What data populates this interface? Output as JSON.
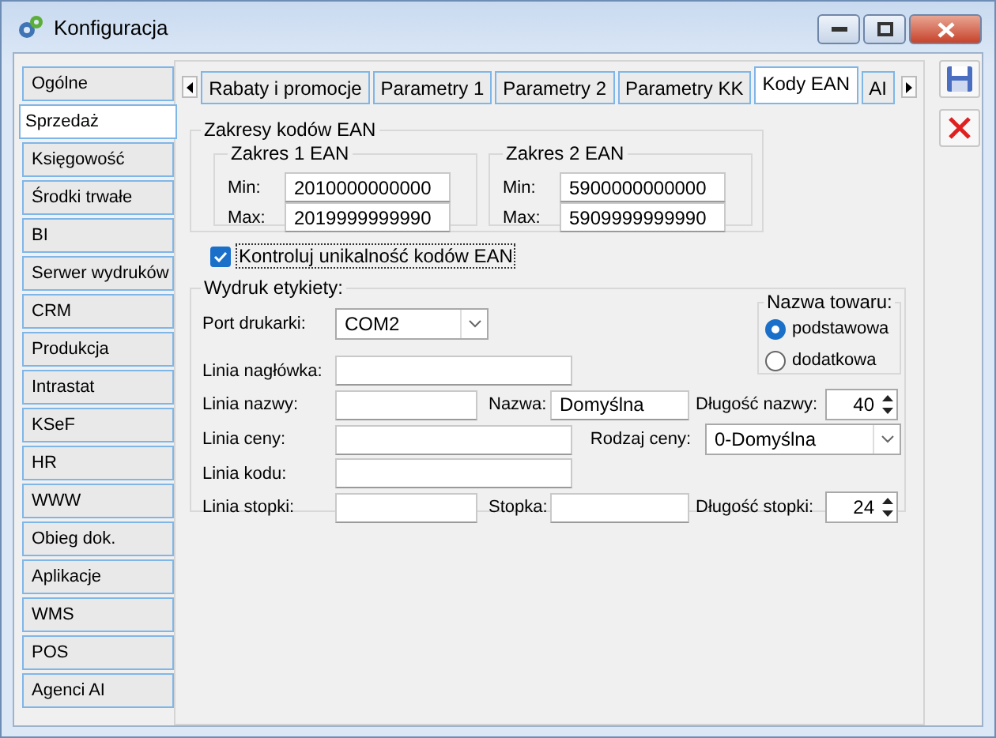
{
  "window": {
    "title": "Konfiguracja"
  },
  "sidebar": {
    "items": [
      {
        "label": "Ogólne",
        "selected": false
      },
      {
        "label": "Sprzedaż",
        "selected": true
      },
      {
        "label": "Księgowość",
        "selected": false
      },
      {
        "label": "Środki trwałe",
        "selected": false
      },
      {
        "label": "BI",
        "selected": false
      },
      {
        "label": "Serwer wydruków",
        "selected": false
      },
      {
        "label": "CRM",
        "selected": false
      },
      {
        "label": "Produkcja",
        "selected": false
      },
      {
        "label": "Intrastat",
        "selected": false
      },
      {
        "label": "KSeF",
        "selected": false
      },
      {
        "label": "HR",
        "selected": false
      },
      {
        "label": "WWW",
        "selected": false
      },
      {
        "label": "Obieg dok.",
        "selected": false
      },
      {
        "label": "Aplikacje",
        "selected": false
      },
      {
        "label": "WMS",
        "selected": false
      },
      {
        "label": "POS",
        "selected": false
      },
      {
        "label": "Agenci AI",
        "selected": false
      }
    ]
  },
  "tabs": [
    {
      "label": "Rabaty i promocje",
      "selected": false
    },
    {
      "label": "Parametry 1",
      "selected": false
    },
    {
      "label": "Parametry 2",
      "selected": false
    },
    {
      "label": "Parametry KK",
      "selected": false
    },
    {
      "label": "Kody EAN",
      "selected": true
    },
    {
      "label": "AI",
      "selected": false
    }
  ],
  "ean_ranges": {
    "title": "Zakresy kodów EAN",
    "ranges": [
      {
        "title": "Zakres 1 EAN",
        "min_label": "Min:",
        "min": "2010000000000",
        "max_label": "Max:",
        "max": "2019999999990"
      },
      {
        "title": "Zakres 2 EAN",
        "min_label": "Min:",
        "min": "5900000000000",
        "max_label": "Max:",
        "max": "5909999999990"
      }
    ]
  },
  "unique_check": {
    "label": "Kontroluj unikalność kodów EAN",
    "checked": true
  },
  "label_print": {
    "title": "Wydruk etykiety:",
    "port": {
      "label": "Port drukarki:",
      "value": "COM2"
    },
    "product_name": {
      "title": "Nazwa towaru:",
      "options": [
        {
          "label": "podstawowa",
          "selected": true
        },
        {
          "label": "dodatkowa",
          "selected": false
        }
      ]
    },
    "header_line": {
      "label": "Linia nagłówka:"
    },
    "name_line": {
      "label": "Linia nazwy:"
    },
    "name": {
      "label": "Nazwa:",
      "value": "Domyślna"
    },
    "name_length": {
      "label": "Długość nazwy:",
      "value": "40"
    },
    "price_line": {
      "label": "Linia ceny:"
    },
    "price_type": {
      "label": "Rodzaj ceny:",
      "value": "0-Domyślna"
    },
    "code_line": {
      "label": "Linia kodu:"
    },
    "footer_line": {
      "label": "Linia stopki:"
    },
    "footer": {
      "label": "Stopka:"
    },
    "footer_length": {
      "label": "Długość stopki:",
      "value": "24"
    }
  }
}
